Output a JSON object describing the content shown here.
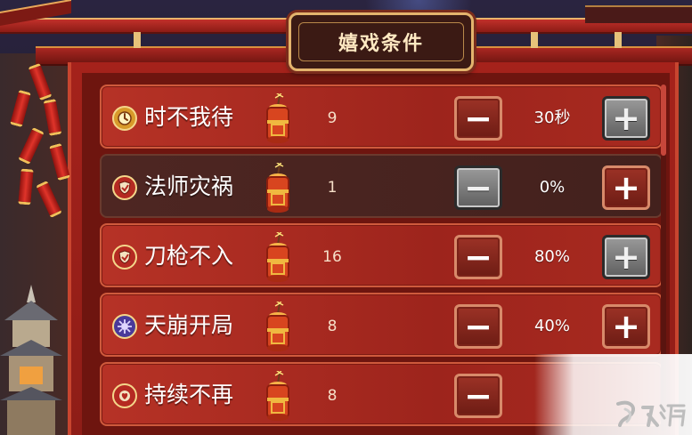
{
  "title": "嬉戏条件",
  "colors": {
    "active_row": "#b63226",
    "inactive_row": "#4e2622",
    "button_red": "#9c3226",
    "button_gray": "#7d7d7d",
    "title_text": "#ffe9c2"
  },
  "rows": [
    {
      "name": "时不我待",
      "icon": "clock-badge-icon",
      "cost": "9",
      "value": "30秒",
      "active": true,
      "minus_style": "red",
      "plus_style": "gray"
    },
    {
      "name": "法师灾祸",
      "icon": "shield-badge-icon",
      "cost": "1",
      "value": "0%",
      "active": false,
      "minus_style": "gray",
      "plus_style": "red"
    },
    {
      "name": "刀枪不入",
      "icon": "shield-badge-icon",
      "cost": "16",
      "value": "80%",
      "active": true,
      "minus_style": "red",
      "plus_style": "gray"
    },
    {
      "name": "天崩开局",
      "icon": "burst-badge-icon",
      "cost": "8",
      "value": "40%",
      "active": true,
      "minus_style": "red",
      "plus_style": "red"
    },
    {
      "name": "持续不再",
      "icon": "heart-badge-icon",
      "cost": "8",
      "value": "",
      "active": true,
      "minus_style": "red",
      "plus_style": "hidden"
    }
  ],
  "buttons": {
    "minus_glyph": "−",
    "plus_glyph": "+"
  },
  "watermark": {
    "logo_icon": "jiuyou-logo-icon"
  }
}
